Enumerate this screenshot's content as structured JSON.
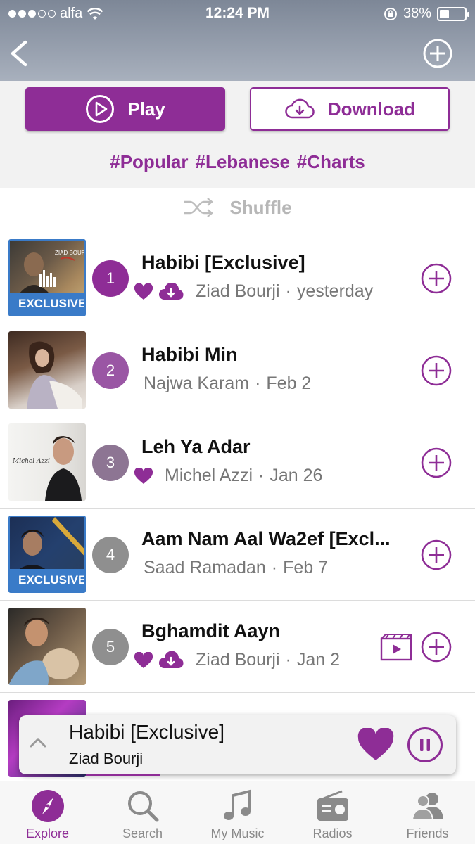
{
  "status_bar": {
    "carrier": "alfa",
    "time": "12:24 PM",
    "battery": "38%"
  },
  "actions": {
    "play_label": "Play",
    "download_label": "Download",
    "tags": [
      "#Popular",
      "#Lebanese",
      "#Charts"
    ]
  },
  "shuffle_label": "Shuffle",
  "tracks": [
    {
      "rank": "1",
      "title": "Habibi [Exclusive]",
      "artist": "Ziad Bourji",
      "date": "yesterday",
      "exclusive": "EXCLUSIVE",
      "liked": true,
      "downloaded": true,
      "rank_color": "#8e2d96"
    },
    {
      "rank": "2",
      "title": "Habibi Min",
      "artist": "Najwa Karam",
      "date": "Feb 2",
      "liked": false,
      "downloaded": false,
      "rank_color": "#9a56a4"
    },
    {
      "rank": "3",
      "title": "Leh Ya Adar",
      "artist": "Michel Azzi",
      "date": "Jan 26",
      "liked": true,
      "downloaded": false,
      "rank_color": "#8d7593"
    },
    {
      "rank": "4",
      "title": "Aam Nam Aal Wa2ef [Excl...",
      "artist": "Saad Ramadan",
      "date": "Feb 7",
      "exclusive": "EXCLUSIVE",
      "liked": false,
      "downloaded": false,
      "rank_color": "#8f8f8f"
    },
    {
      "rank": "5",
      "title": "Bghamdit Aayn",
      "artist": "Ziad Bourji",
      "date": "Jan 2",
      "liked": true,
      "downloaded": true,
      "video": true,
      "rank_color": "#8f8f8f"
    }
  ],
  "separator": "·",
  "now_playing": {
    "title": "Habibi [Exclusive]",
    "artist": "Ziad Bourji",
    "progress": 0.17
  },
  "tabs": [
    {
      "label": "Explore",
      "icon": "compass-icon",
      "active": true
    },
    {
      "label": "Search",
      "icon": "search-icon",
      "active": false
    },
    {
      "label": "My Music",
      "icon": "music-note-icon",
      "active": false
    },
    {
      "label": "Radios",
      "icon": "radio-icon",
      "active": false
    },
    {
      "label": "Friends",
      "icon": "friends-icon",
      "active": false
    }
  ],
  "colors": {
    "accent": "#8e2d96",
    "exclusive_badge": "#3a7bc8",
    "header": "#8790a0"
  }
}
